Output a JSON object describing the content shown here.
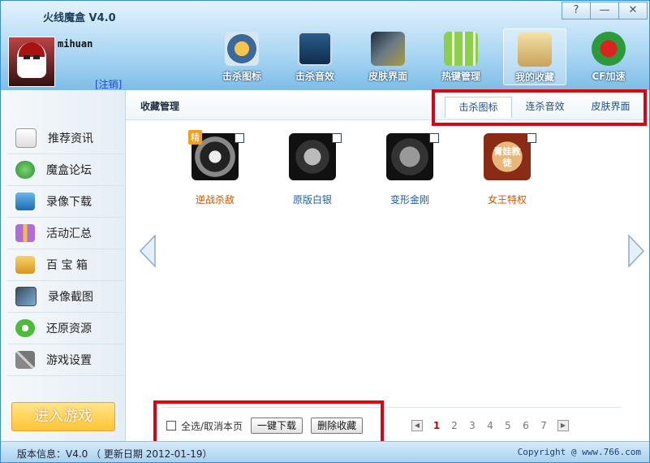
{
  "app": {
    "title": "火线魔盒 V4.0",
    "window_controls": [
      "?",
      "—",
      "✕"
    ]
  },
  "user": {
    "name": "mihuan",
    "logout_label": "[注销]"
  },
  "nav": [
    {
      "label": "击杀图标",
      "icon": "crosshair-badge-icon"
    },
    {
      "label": "击杀音效",
      "icon": "sound-meter-icon"
    },
    {
      "label": "皮肤界面",
      "icon": "skin-poster-icon"
    },
    {
      "label": "热键管理",
      "icon": "keyboard-icon"
    },
    {
      "label": "我的收藏",
      "icon": "toolbox-icon"
    },
    {
      "label": "CF加速",
      "icon": "cf-logo-icon"
    }
  ],
  "sidebar": {
    "items": [
      {
        "label": "推荐资讯",
        "icon": "newspaper-icon"
      },
      {
        "label": "魔盒论坛",
        "icon": "chat-bubbles-icon"
      },
      {
        "label": "录像下载",
        "icon": "download-icon"
      },
      {
        "label": "活动汇总",
        "icon": "gift-icon"
      },
      {
        "label": "百 宝 箱",
        "icon": "treasure-box-icon"
      },
      {
        "label": "录像截图",
        "icon": "screenshot-icon"
      },
      {
        "label": "还原资源",
        "icon": "restore-icon"
      },
      {
        "label": "游戏设置",
        "icon": "tools-icon"
      }
    ],
    "enter_game_label": "进入游戏"
  },
  "content": {
    "title": "收藏管理",
    "tabs": [
      "击杀图标",
      "连杀音效",
      "皮肤界面"
    ],
    "active_tab": "击杀图标",
    "favorites": [
      {
        "label": "逆战杀敌",
        "badge": "精",
        "icon": "skull-star-icon"
      },
      {
        "label": "原版白银",
        "icon": "silver-skull-icon"
      },
      {
        "label": "变形金刚",
        "icon": "transformers-icon"
      },
      {
        "label": "女王特权",
        "text": "青娃教徒",
        "icon": "queen-badge-icon"
      }
    ],
    "select_all_label": "全选/取消本页",
    "download_button": "一键下载",
    "delete_button": "删除收藏",
    "pages": [
      "1",
      "2",
      "3",
      "4",
      "5",
      "6",
      "7"
    ],
    "current_page": "1"
  },
  "status": {
    "version": "版本信息：V4.0 （ 更新日期 2012-01-19）",
    "copyright": "Copyright @ www.766.com"
  },
  "colors": {
    "header": "#7ebde8",
    "highlight": "#e00012",
    "link": "#1b4fc2",
    "current_page": "#d20000"
  }
}
